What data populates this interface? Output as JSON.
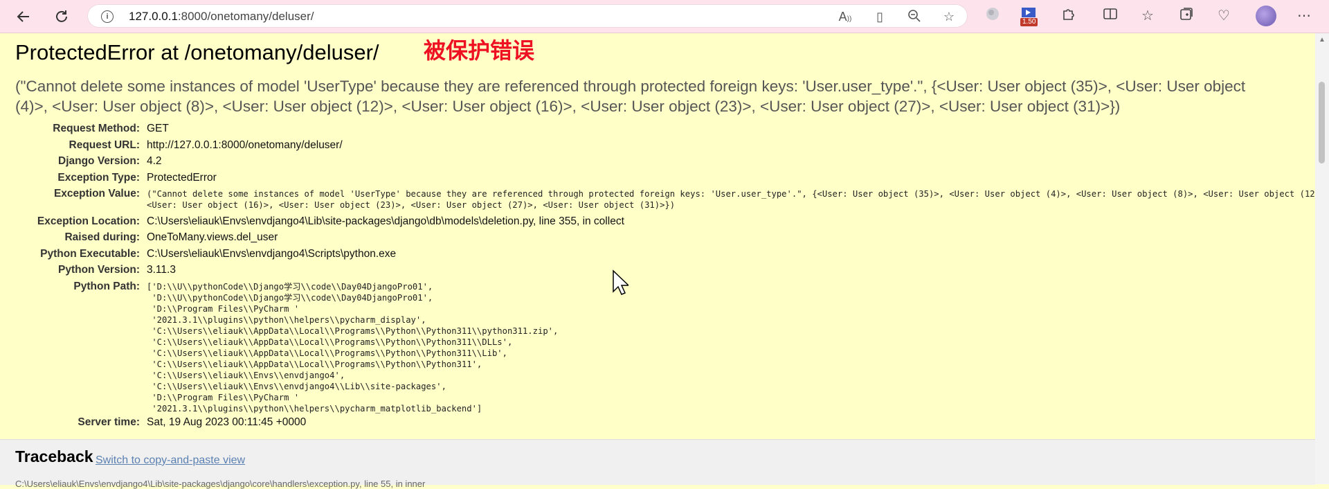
{
  "browser": {
    "url_host": "127.0.0.1",
    "url_rest": ":8000/onetomany/deluser/",
    "download_badge": "1.50",
    "icons": [
      "back-icon",
      "refresh-icon",
      "info-icon",
      "read-aloud-icon",
      "immersive-reader-icon",
      "zoom-icon",
      "favorite-icon",
      "extension-puzzle-icon",
      "split-screen-icon",
      "favorites-icon",
      "collections-icon",
      "health-icon",
      "menu-icon"
    ]
  },
  "page": {
    "title": "ProtectedError at /onetomany/deluser/",
    "annotation": "被保护错误",
    "exception_summary": "(\"Cannot delete some instances of model 'UserType' because they are referenced through protected foreign keys: 'User.user_type'.\", {<User: User object (35)>, <User: User object (4)>, <User: User object (8)>, <User: User object (12)>, <User: User object (16)>, <User: User object (23)>, <User: User object (27)>, <User: User object (31)>})",
    "meta": {
      "request_method_label": "Request Method:",
      "request_method": "GET",
      "request_url_label": "Request URL:",
      "request_url": "http://127.0.0.1:8000/onetomany/deluser/",
      "django_version_label": "Django Version:",
      "django_version": "4.2",
      "exception_type_label": "Exception Type:",
      "exception_type": "ProtectedError",
      "exception_value_label": "Exception Value:",
      "exception_value": "(\"Cannot delete some instances of model 'UserType' because they are referenced through protected foreign keys: 'User.user_type'.\", {<User: User object (35)>, <User: User object (4)>, <User: User object (8)>, <User: User object (12)>,\n<User: User object (16)>, <User: User object (23)>, <User: User object (27)>, <User: User object (31)>})",
      "exception_location_label": "Exception Location:",
      "exception_location": "C:\\Users\\eliauk\\Envs\\envdjango4\\Lib\\site-packages\\django\\db\\models\\deletion.py, line 355, in collect",
      "raised_during_label": "Raised during:",
      "raised_during": "OneToMany.views.del_user",
      "python_executable_label": "Python Executable:",
      "python_executable": "C:\\Users\\eliauk\\Envs\\envdjango4\\Scripts\\python.exe",
      "python_version_label": "Python Version:",
      "python_version": "3.11.3",
      "python_path_label": "Python Path:",
      "python_path": "['D:\\\\U\\\\pythonCode\\\\Django学习\\\\code\\\\Day04DjangoPro01',\n 'D:\\\\U\\\\pythonCode\\\\Django学习\\\\code\\\\Day04DjangoPro01',\n 'D:\\\\Program Files\\\\PyCharm '\n '2021.3.1\\\\plugins\\\\python\\\\helpers\\\\pycharm_display',\n 'C:\\\\Users\\\\eliauk\\\\AppData\\\\Local\\\\Programs\\\\Python\\\\Python311\\\\python311.zip',\n 'C:\\\\Users\\\\eliauk\\\\AppData\\\\Local\\\\Programs\\\\Python\\\\Python311\\\\DLLs',\n 'C:\\\\Users\\\\eliauk\\\\AppData\\\\Local\\\\Programs\\\\Python\\\\Python311\\\\Lib',\n 'C:\\\\Users\\\\eliauk\\\\AppData\\\\Local\\\\Programs\\\\Python\\\\Python311',\n 'C:\\\\Users\\\\eliauk\\\\Envs\\\\envdjango4',\n 'C:\\\\Users\\\\eliauk\\\\Envs\\\\envdjango4\\\\Lib\\\\site-packages',\n 'D:\\\\Program Files\\\\PyCharm '\n '2021.3.1\\\\plugins\\\\python\\\\helpers\\\\pycharm_matplotlib_backend']",
      "server_time_label": "Server time:",
      "server_time": "Sat, 19 Aug 2023 00:11:45 +0000"
    },
    "traceback_heading": "Traceback",
    "traceback_link": "Switch to copy-and-paste view",
    "traceback_cut_line": "C:\\Users\\eliauk\\Envs\\envdjango4\\Lib\\site-packages\\django\\core\\handlers\\exception.py, line 55, in inner"
  },
  "colors": {
    "chrome_bg": "#fde3ec",
    "page_bg": "#ffffc8",
    "annotation": "#ee1122",
    "link": "#5b80b2"
  }
}
